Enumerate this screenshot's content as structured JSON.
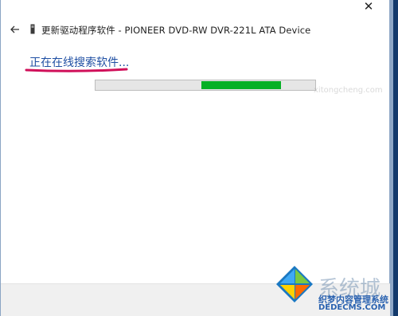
{
  "window": {
    "close_glyph": "✕",
    "title": "更新驱动程序软件 - PIONEER DVD-RW  DVR-221L ATA Device"
  },
  "status_text": "正在在线搜索软件...",
  "progress": {
    "indeterminate": true,
    "fill_color": "#06b025"
  },
  "watermark": {
    "brand": "系统城",
    "faint_text": "xitongcheng.com",
    "site_name": "织梦内容管理系统",
    "url": "DEDECMS.COM"
  },
  "colors": {
    "accent": "#1f4fa3",
    "annotation": "#d0105a",
    "progress_green": "#06b025"
  },
  "icons": {
    "back": "back-arrow-icon",
    "device": "device-icon",
    "logo": "windows-logo-icon"
  }
}
